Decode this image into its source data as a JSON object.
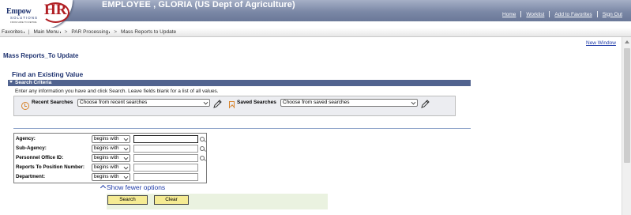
{
  "header": {
    "employee_title": "EMPLOYEE , GLORIA (US Dept of Agriculture)",
    "logo": {
      "word_a": "Empow",
      "word_b": "HR",
      "tagline": "SOLUTIONS",
      "subtag": "FROM HIRE TO RETIRE",
      "brand_color": "#b01e23",
      "navy_color": "#1f3370"
    },
    "links": [
      "Home",
      "Worklist",
      "Add to Favorites",
      "Sign Out"
    ]
  },
  "breadcrumb": [
    "Favorites",
    "Main Menu",
    "PAR Processing",
    "Mass Reports to Update"
  ],
  "new_window_label": "New Window",
  "page_title": "Mass Reports_To Update",
  "find_title": "Find an Existing Value",
  "search_criteria": {
    "label": "Search Criteria",
    "instructions": "Enter any information you have and click Search. Leave fields blank for a list of all values.",
    "recent": {
      "label": "Recent Searches",
      "placeholder": "Choose from recent searches",
      "icon": "clock-icon"
    },
    "saved": {
      "label": "Saved Searches",
      "placeholder": "Choose from saved searches",
      "icon": "bookmark-icon"
    },
    "fields": [
      {
        "label": "Agency:",
        "operator": "begins with",
        "value": "",
        "lookup": true
      },
      {
        "label": "Sub-Agency:",
        "operator": "begins with",
        "value": "",
        "lookup": true
      },
      {
        "label": "Personnel Office ID:",
        "operator": "begins with",
        "value": "",
        "lookup": true
      },
      {
        "label": "Reports To Position Number:",
        "operator": "begins with",
        "value": "",
        "lookup": false
      },
      {
        "label": "Department:",
        "operator": "begins with",
        "value": "",
        "lookup": false
      }
    ],
    "show_fewer_label": "Show fewer options",
    "search_button": "Search",
    "clear_button": "Clear"
  },
  "colors": {
    "header_bar": "#7b88a6",
    "section_bar": "#51638f",
    "link": "#1f3ba8",
    "button_fill": "#f5eb93",
    "button_bar": "#eaf2e0"
  }
}
